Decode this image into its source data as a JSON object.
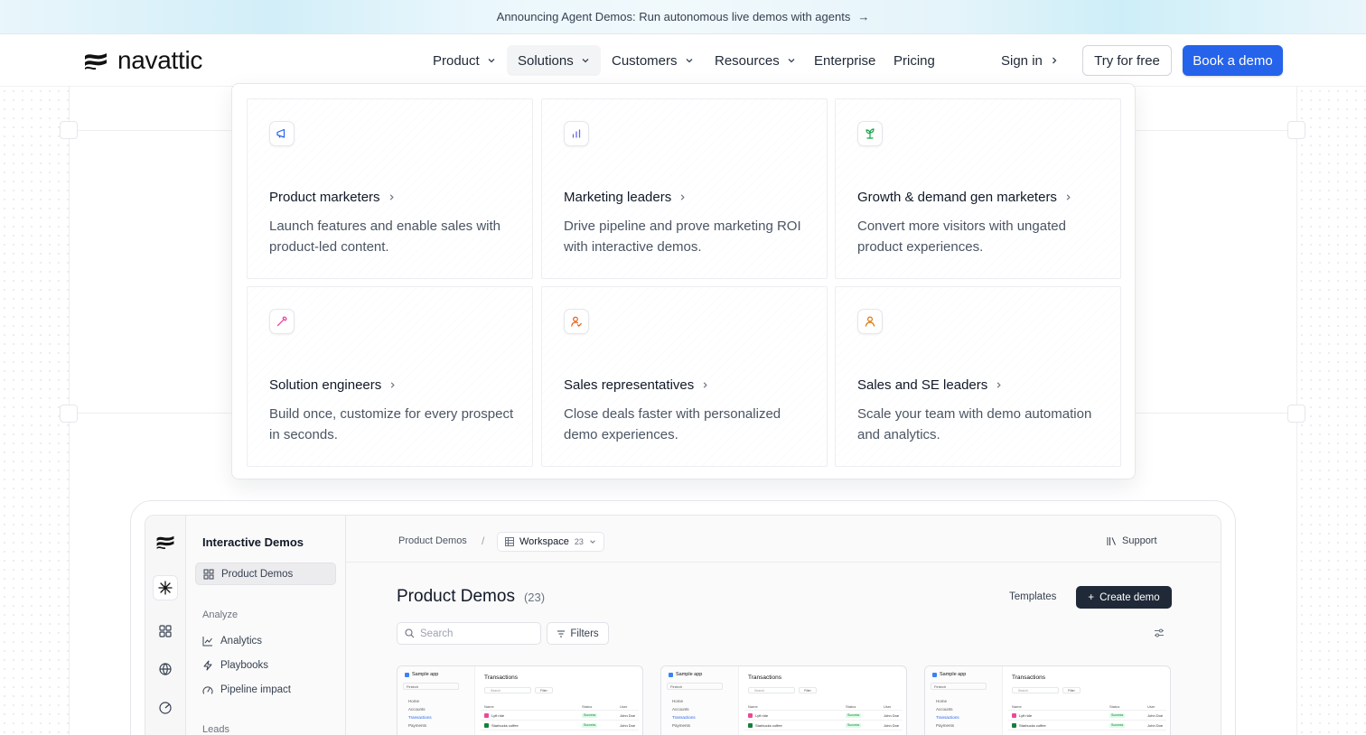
{
  "announcement": {
    "text": "Announcing Agent Demos: Run autonomous live demos with agents",
    "arrow": "→"
  },
  "brand": {
    "name": "navattic"
  },
  "nav": {
    "items": [
      {
        "label": "Product",
        "has_menu": true
      },
      {
        "label": "Solutions",
        "has_menu": true,
        "active": true
      },
      {
        "label": "Customers",
        "has_menu": true
      },
      {
        "label": "Resources",
        "has_menu": true
      },
      {
        "label": "Enterprise",
        "has_menu": false
      },
      {
        "label": "Pricing",
        "has_menu": false
      }
    ],
    "sign_in": "Sign in",
    "try_free": "Try for free",
    "book_demo": "Book a demo"
  },
  "colors": {
    "primary": "#2563eb",
    "text": "#111827",
    "muted": "#4b5563",
    "icon_blue": "#2563eb",
    "icon_indigo": "#6366f1",
    "icon_green": "#16a34a",
    "icon_pink": "#ec4899",
    "icon_orange": "#ea580c",
    "icon_amber": "#d97706"
  },
  "solutions_menu": [
    {
      "icon": "megaphone-icon",
      "title": "Product marketers",
      "desc": "Launch features and enable sales with product-led content."
    },
    {
      "icon": "bar-chart-icon",
      "title": "Marketing leaders",
      "desc": "Drive pipeline and prove marketing ROI with interactive demos."
    },
    {
      "icon": "sprout-icon",
      "title": "Growth & demand gen marketers",
      "desc": "Convert more visitors with ungated product experiences."
    },
    {
      "icon": "wrench-icon",
      "title": "Solution engineers",
      "desc": "Build once, customize for every prospect in seconds."
    },
    {
      "icon": "user-check-icon",
      "title": "Sales representatives",
      "desc": "Close deals faster with personalized demo experiences."
    },
    {
      "icon": "user-icon",
      "title": "Sales and SE leaders",
      "desc": "Scale your team with demo automation and analytics."
    }
  ],
  "app_preview": {
    "sidebar_title": "Interactive Demos",
    "sidebar_selected": "Product Demos",
    "section_analyze": "Analyze",
    "analyze_items": [
      "Analytics",
      "Playbooks",
      "Pipeline impact"
    ],
    "section_leads": "Leads",
    "breadcrumb": "Product Demos",
    "breadcrumb_sep": "/",
    "workspace_label": "Workspace",
    "workspace_count": "23",
    "support": "Support",
    "page_title": "Product Demos",
    "page_count": "(23)",
    "templates": "Templates",
    "create_demo": "Create demo",
    "search_placeholder": "Search",
    "filters": "Filters",
    "thumbnail": {
      "app_name": "Sample app",
      "select": "Fintech",
      "nav": [
        "Home",
        "Accounts",
        "Transactions",
        "Payments"
      ],
      "title": "Transactions",
      "search": "Search",
      "filter": "Filter",
      "headers": [
        "Name",
        "Status",
        "User"
      ],
      "rows": [
        {
          "name": "Lyft ride",
          "status": "Success",
          "user": "John Doe"
        },
        {
          "name": "Starbucks coffee",
          "status": "Success",
          "user": "John Doe"
        }
      ]
    }
  }
}
